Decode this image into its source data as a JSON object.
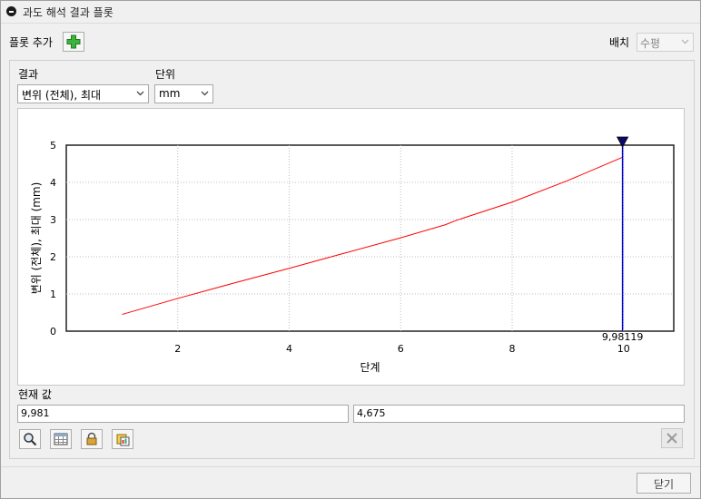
{
  "window": {
    "title": "과도 해석 결과 플롯"
  },
  "toolbar": {
    "add_plot_label": "플롯 추가",
    "layout_label": "배치",
    "layout_value": "수평"
  },
  "result": {
    "result_label": "결과",
    "result_value": "변위 (전체), 최대",
    "unit_label": "단위",
    "unit_value": "mm"
  },
  "chart_data": {
    "type": "line",
    "xlabel": "단계",
    "ylabel": "변위 (전체), 최대 (mm)",
    "xlim": [
      0,
      10.9
    ],
    "ylim": [
      0,
      5
    ],
    "xticks": [
      2,
      4,
      6,
      8,
      10
    ],
    "yticks": [
      0,
      1,
      2,
      3,
      4,
      5
    ],
    "grid": true,
    "series": [
      {
        "color": "#ff0000",
        "x": [
          1,
          2,
          3,
          4,
          5,
          6,
          6.8,
          7,
          8,
          9,
          9.98119
        ],
        "y": [
          0.45,
          0.88,
          1.29,
          1.69,
          2.1,
          2.51,
          2.86,
          2.98,
          3.47,
          4.05,
          4.675
        ]
      }
    ],
    "cursor": {
      "x": 9.98119,
      "label": "9,98119",
      "color": "#0000cc"
    }
  },
  "current": {
    "label": "현재 값",
    "x_value": "9,981",
    "y_value": "4,675"
  },
  "buttons": {
    "close_label": "닫기"
  },
  "icons": [
    "zoom-icon",
    "table-icon",
    "lock-icon",
    "export-icon",
    "delete-icon",
    "add-icon"
  ]
}
